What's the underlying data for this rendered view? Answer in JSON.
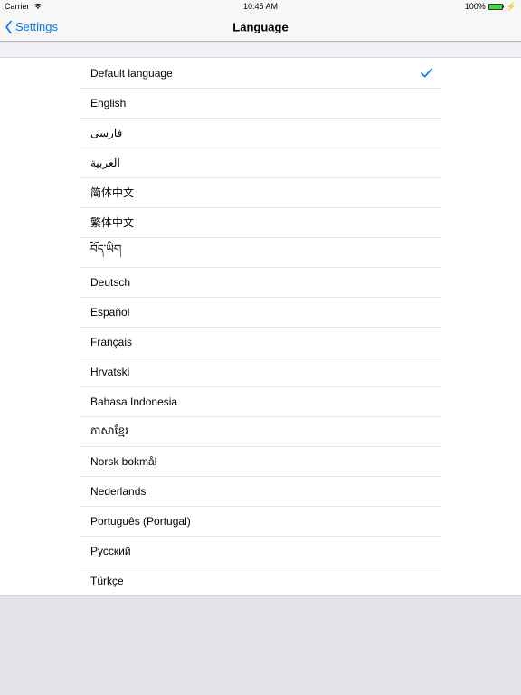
{
  "status_bar": {
    "carrier": "Carrier",
    "time": "10:45 AM",
    "battery_percent": "100%"
  },
  "nav": {
    "back_label": "Settings",
    "title": "Language"
  },
  "languages": [
    {
      "label": "Default language",
      "selected": true
    },
    {
      "label": "English",
      "selected": false
    },
    {
      "label": "فارسی",
      "selected": false
    },
    {
      "label": "العربية",
      "selected": false
    },
    {
      "label": "简体中文",
      "selected": false
    },
    {
      "label": "繁体中文",
      "selected": false
    },
    {
      "label": "བོད་ཡིག",
      "selected": false
    },
    {
      "label": "Deutsch",
      "selected": false
    },
    {
      "label": "Español",
      "selected": false
    },
    {
      "label": "Français",
      "selected": false
    },
    {
      "label": "Hrvatski",
      "selected": false
    },
    {
      "label": "Bahasa Indonesia",
      "selected": false
    },
    {
      "label": "ភាសាខ្មែរ",
      "selected": false
    },
    {
      "label": "Norsk bokmål",
      "selected": false
    },
    {
      "label": "Nederlands",
      "selected": false
    },
    {
      "label": "Português (Portugal)",
      "selected": false
    },
    {
      "label": "Русский",
      "selected": false
    },
    {
      "label": "Türkçe",
      "selected": false
    }
  ],
  "colors": {
    "tint": "#007aff"
  }
}
